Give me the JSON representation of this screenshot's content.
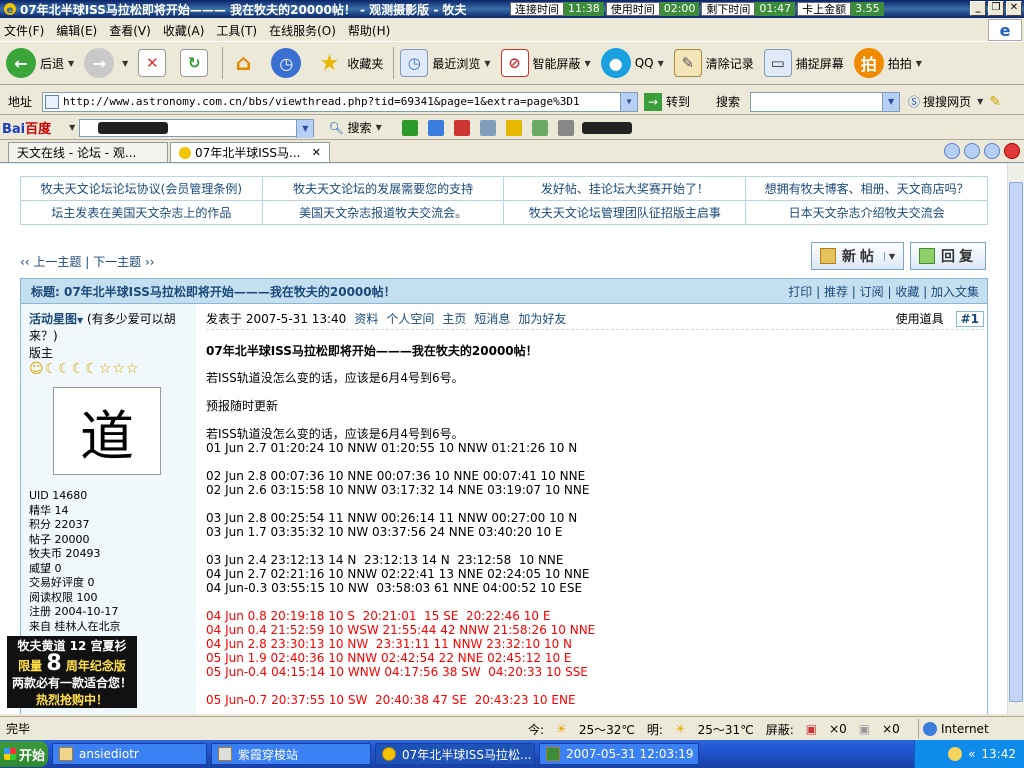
{
  "window": {
    "title": "07年北半球ISS马拉松即将开始——— 我在牧夫的20000帖！ - 观测摄影版 - 牧夫",
    "timers": [
      {
        "label": "连接时间",
        "value": "11:38"
      },
      {
        "label": "使用时间",
        "value": "02:00"
      },
      {
        "label": "剩下时间",
        "value": "01:47"
      },
      {
        "label": "卡上金额",
        "value": "3.55"
      }
    ]
  },
  "menu": [
    "文件(F)",
    "编辑(E)",
    "查看(V)",
    "收藏(A)",
    "工具(T)",
    "在线服务(O)",
    "帮助(H)"
  ],
  "toolbar": {
    "back": "后退",
    "favorites": "收藏夹",
    "recent": "最近浏览",
    "smart_block": "智能屏蔽",
    "qq": "QQ",
    "clear": "清除记录",
    "capture": "捕捉屏幕",
    "paipai": "拍拍",
    "paipai_icon": "拍"
  },
  "address": {
    "label": "地址",
    "url": "http://www.astronomy.com.cn/bbs/viewthread.php?tid=69341&page=1&extra=page%3D1",
    "go": "转到",
    "search_label": "搜索",
    "search_web": "搜搜网页"
  },
  "baidu": {
    "logo_a": "Bai",
    "logo_b": "百度",
    "search": "搜索"
  },
  "tabs": [
    {
      "label": "天文在线 - 论坛 - 观..."
    },
    {
      "label": "07年北半球ISS马..."
    }
  ],
  "announcements": [
    [
      "牧夫天文论坛论坛协议(会员管理条例)",
      "牧夫天文论坛的发展需要您的支持",
      "发好帖、挂论坛大奖赛开始了！",
      "想拥有牧夫博客、相册、天文商店吗？"
    ],
    [
      "坛主发表在美国天文杂志上的作品",
      "美国天文杂志报道牧夫交流会。",
      "牧夫天文论坛管理团队征招版主启事",
      "日本天文杂志介绍牧夫交流会"
    ]
  ],
  "nav": {
    "prev": "‹‹ 上一主题",
    "sep": "|",
    "next": "下一主题 ››",
    "new_post": "新帖",
    "reply": "回复"
  },
  "thread": {
    "title": "标题: 07年北半球ISS马拉松即将开始———我在牧夫的20000帖！",
    "actions": "打印 | 推荐 | 订阅 | 收藏 | 加入文集"
  },
  "user": {
    "name": "活动星图",
    "motto": "(有多少爱可以胡来？)",
    "role": "版主",
    "rank_icons": "☺☾☾☾☾☆☆☆",
    "avatar_text": "道",
    "info": [
      "UID 14680",
      "精华 14",
      "积分 22037",
      "帖子 20000",
      "牧夫币 20493",
      "威望 0",
      "交易好评度 0",
      "阅读权限 100",
      "注册 2004-10-17",
      "来自 桂林人在北京"
    ],
    "promo_l1": "牧夫黄道 12 宫夏衫",
    "promo_l2a": "限量",
    "promo_big": "8",
    "promo_l2b": "周年纪念版",
    "promo_l3": "两款必有一款适合您！",
    "promo_l4": "热烈抢购中！"
  },
  "post": {
    "posted": "发表于 2007-5-31 13:40",
    "links": [
      "资料",
      "个人空间",
      "主页",
      "短消息",
      "加为好友"
    ],
    "tools": "使用道具",
    "floor": "#1",
    "title": "07年北半球ISS马拉松即将开始———我在牧夫的20000帖！",
    "intro": "若ISS轨道没怎么变的话，应该是6月4号到6号。",
    "update": "预报随时更新",
    "intro2": "若ISS轨道没怎么变的话，应该是6月4号到6号。",
    "lines_black": [
      "01 Jun 2.7 01:20:24 10 NNW 01:20:55 10 NNW 01:21:26 10 N",
      "",
      "02 Jun 2.8 00:07:36 10 NNE 00:07:36 10 NNE 00:07:41 10 NNE",
      "02 Jun 2.6 03:15:58 10 NNW 03:17:32 14 NNE 03:19:07 10 NNE",
      "",
      "03 Jun 2.8 00:25:54 11 NNW 00:26:14 11 NNW 00:27:00 10 N",
      "03 Jun 1.7 03:35:32 10 NW 03:37:56 24 NNE 03:40:20 10 E",
      "",
      "03 Jun 2.4 23:12:13 14 N  23:12:13 14 N  23:12:58  10 NNE",
      "04 Jun 2.7 02:21:16 10 NNW 02:22:41 13 NNE 02:24:05 10 NNE",
      "04 Jun-0.3 03:55:15 10 NW  03:58:03 61 NNE 04:00:52 10 ESE",
      ""
    ],
    "lines_red": [
      "04 Jun 0.8 20:19:18 10 S  20:21:01  15 SE  20:22:46 10 E",
      "04 Jun 0.4 21:52:59 10 WSW 21:55:44 42 NNW 21:58:26 10 NNE",
      "04 Jun 2.8 23:30:13 10 NW  23:31:11 11 NNW 23:32:10 10 N",
      "05 Jun 1.9 02:40:36 10 NNW 02:42:54 22 NNE 02:45:12 10 E",
      "05 Jun-0.4 04:15:14 10 WNW 04:17:56 38 SW  04:20:33 10 SSE",
      "",
      "05 Jun-0.7 20:37:55 10 SW  20:40:38 47 SE  20:43:23 10 ENE"
    ]
  },
  "status": {
    "done": "完毕",
    "today_label": "今:",
    "today_temp": "25～32℃",
    "tomorrow_label": "明:",
    "tomorrow_temp": "25～31℃",
    "block_label": "屏蔽:",
    "block_count_a": "×0",
    "block_count_b": "×0",
    "zone": "Internet"
  },
  "taskbar": {
    "start": "开始",
    "tasks": [
      "ansiediotr",
      "紫霞穿梭站",
      "07年北半球ISS马拉松...",
      "2007-05-31 12:03:19"
    ],
    "clock": "13:42"
  }
}
